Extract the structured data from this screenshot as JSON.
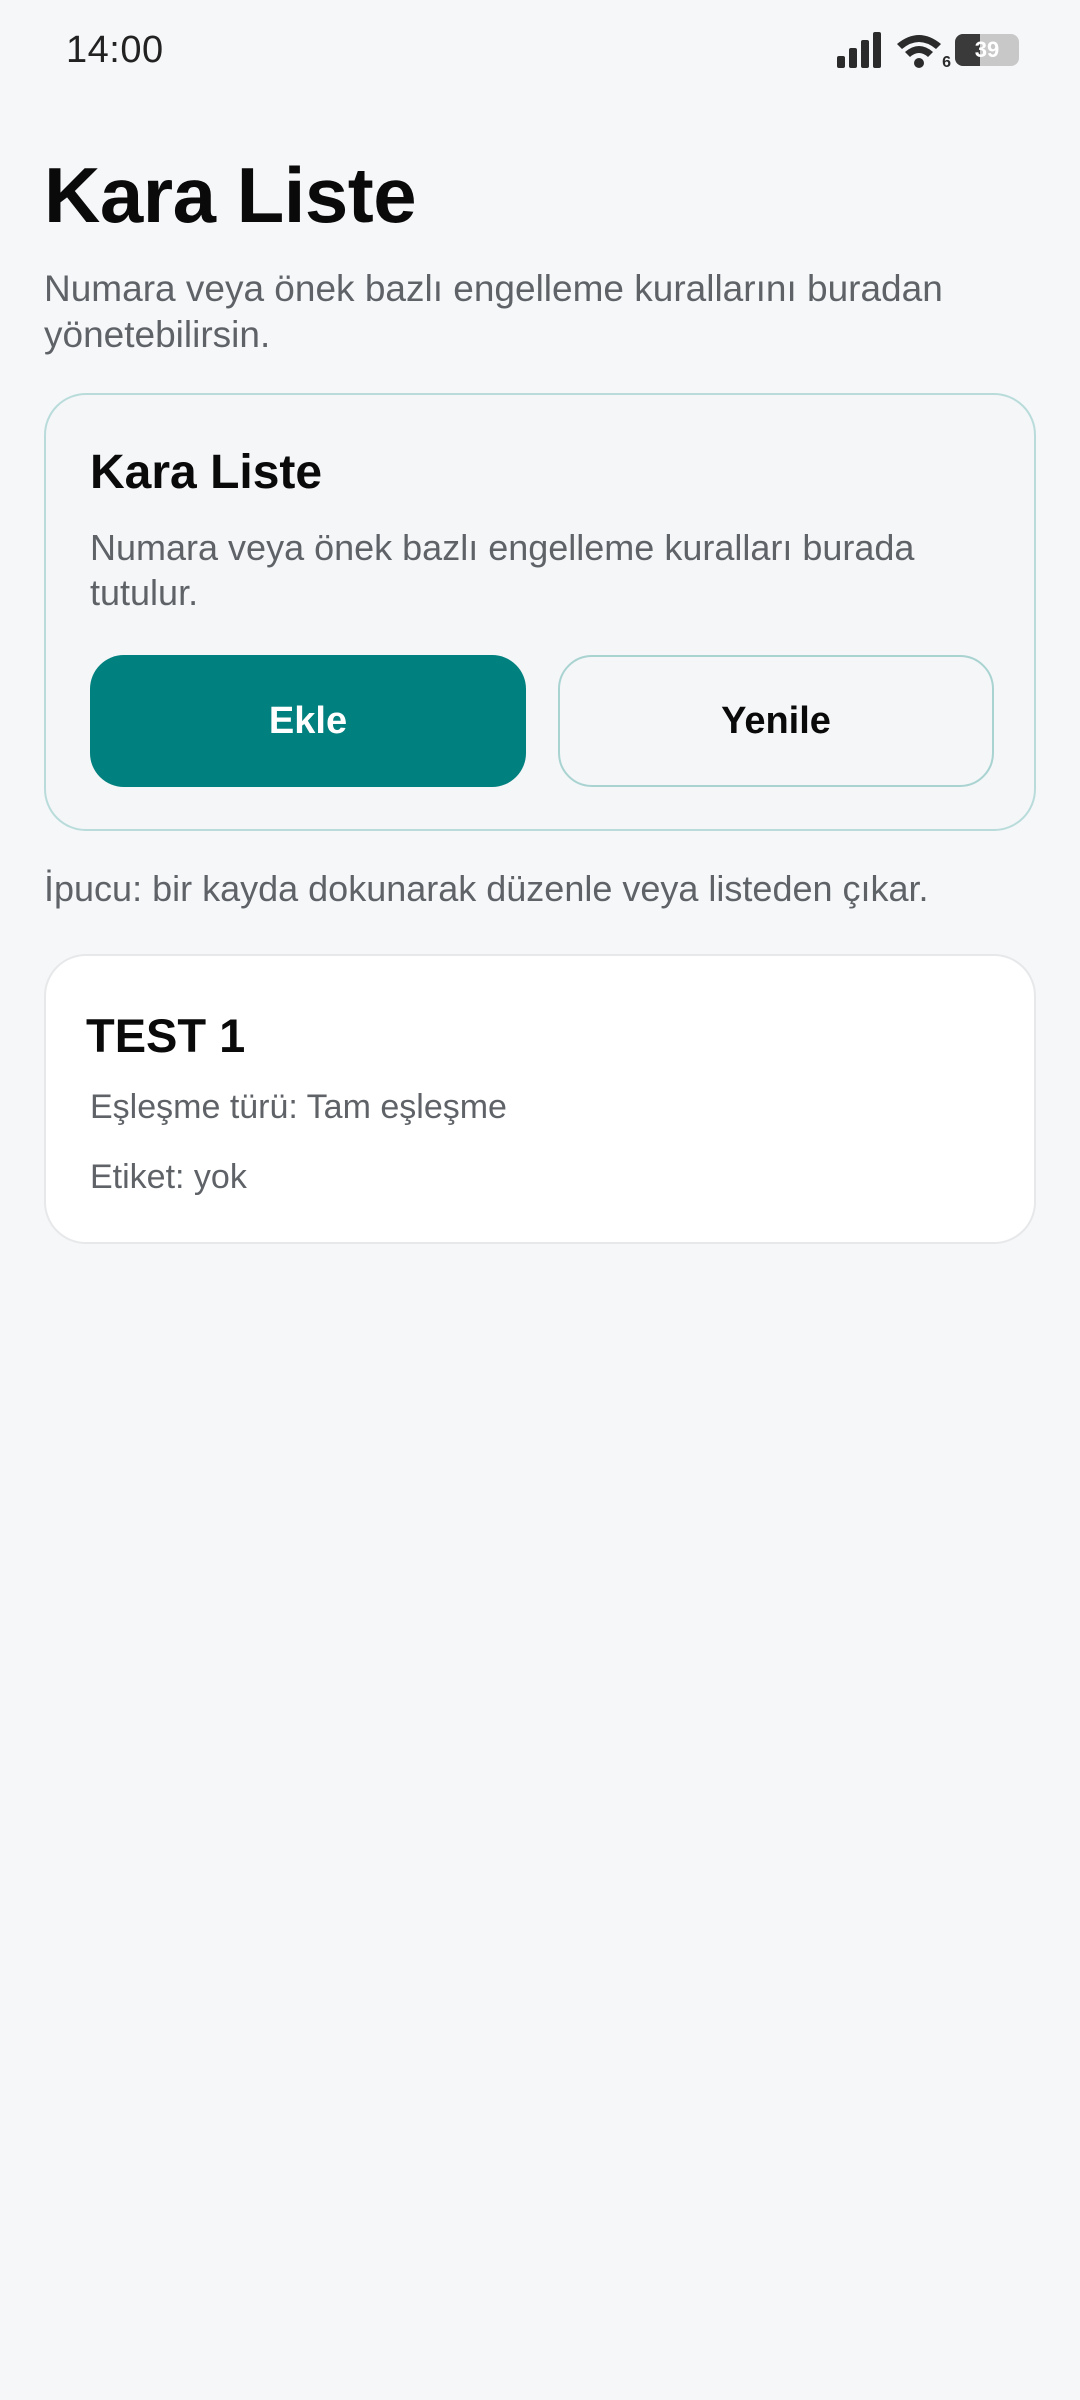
{
  "status_bar": {
    "time": "14:00",
    "battery_level": "39",
    "wifi_badge": "6",
    "icons": [
      "signal-icon",
      "wifi-icon",
      "battery-icon"
    ]
  },
  "header": {
    "title": "Kara Liste",
    "subtitle": "Numara veya önek bazlı engelleme kurallarını buradan yönetebilirsin."
  },
  "action_card": {
    "title": "Kara Liste",
    "description": "Numara veya önek bazlı engelleme kuralları burada tutulur.",
    "add_label": "Ekle",
    "refresh_label": "Yenile"
  },
  "hint": "İpucu: bir kayda dokunarak düzenle veya listeden çıkar.",
  "entries": [
    {
      "name": "TEST 1",
      "match_type": "Eşleşme türü: Tam eşleşme",
      "tag": "Etiket: yok"
    }
  ],
  "colors": {
    "accent": "#00807e",
    "accent_border": "#b9dcdb",
    "background": "#f5f7f9",
    "muted_text": "#5f6368"
  }
}
